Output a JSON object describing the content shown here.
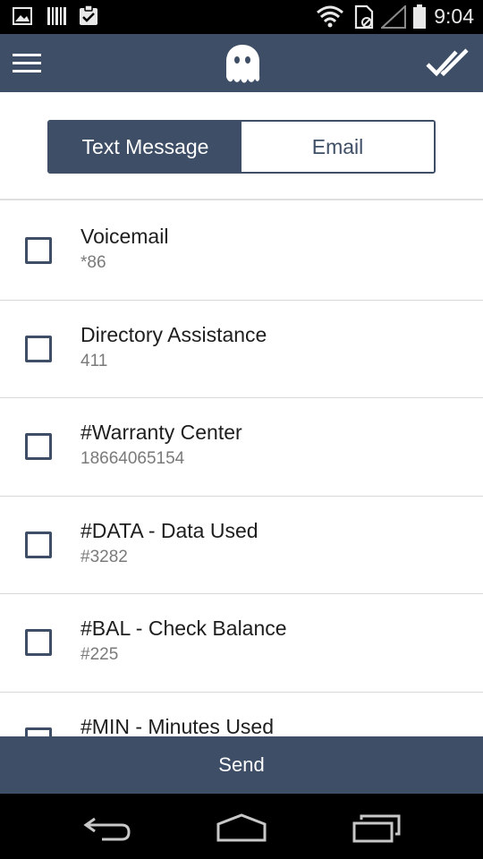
{
  "status_bar": {
    "time": "9:04",
    "icons": [
      "image-icon",
      "barcode-icon",
      "clipboard-check-icon",
      "wifi-icon",
      "sim-icon",
      "signal-icon",
      "battery-icon"
    ]
  },
  "app_bar": {
    "icons": [
      "menu-icon",
      "ghost-logo-icon",
      "done-all-icon"
    ],
    "background": "#3e4e66"
  },
  "tabs": [
    {
      "label": "Text Message",
      "selected": true
    },
    {
      "label": "Email",
      "selected": false
    }
  ],
  "items": [
    {
      "title": "Voicemail",
      "subtitle": "*86",
      "checked": false
    },
    {
      "title": "Directory Assistance",
      "subtitle": "411",
      "checked": false
    },
    {
      "title": "#Warranty Center",
      "subtitle": "18664065154",
      "checked": false
    },
    {
      "title": "#DATA - Data Used",
      "subtitle": "#3282",
      "checked": false
    },
    {
      "title": "#BAL - Check Balance",
      "subtitle": "#225",
      "checked": false
    },
    {
      "title": "#MIN - Minutes Used",
      "subtitle": "",
      "checked": false
    }
  ],
  "send_label": "Send",
  "nav_bar": {
    "icons": [
      "back-icon",
      "home-icon",
      "recent-apps-icon"
    ]
  },
  "colors": {
    "accent": "#3e4e66",
    "divider": "#d9d9d9",
    "subtitle": "#7a7a7a"
  }
}
